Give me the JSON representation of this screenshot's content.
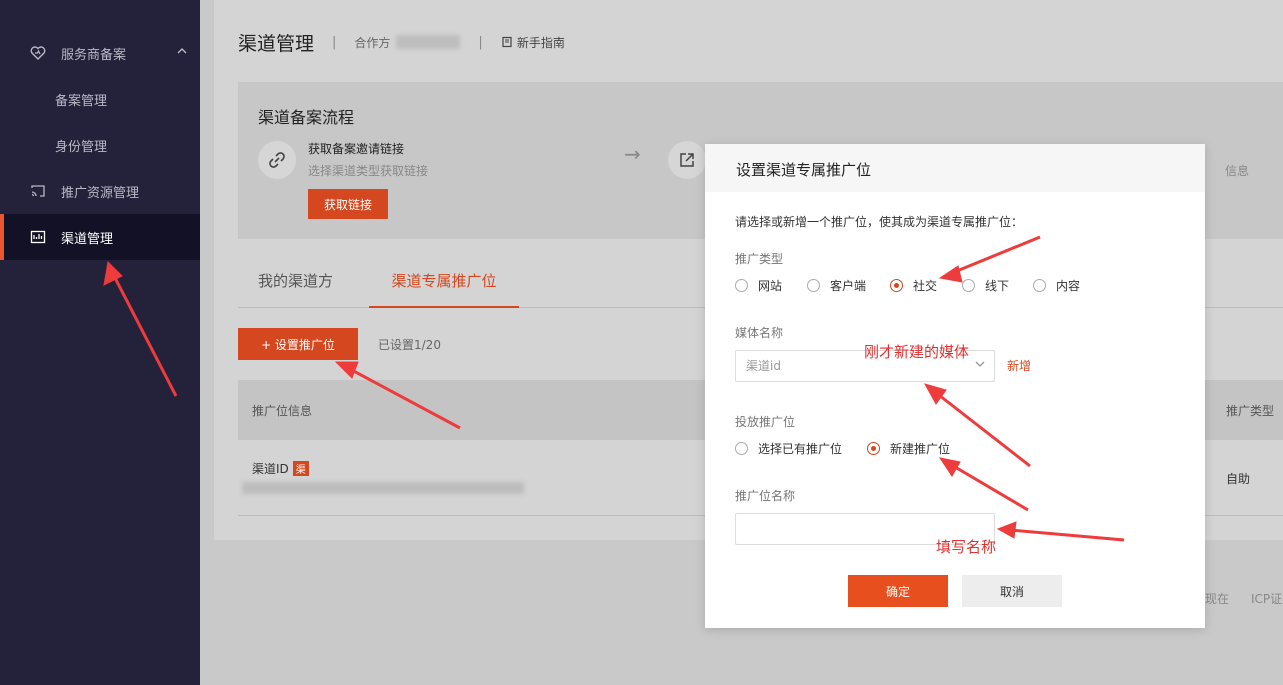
{
  "sidebar": {
    "items": [
      {
        "label": "服务商备案",
        "icon": "heart-icon"
      },
      {
        "label": "备案管理"
      },
      {
        "label": "身份管理"
      },
      {
        "label": "推广资源管理",
        "icon": "cast-icon"
      },
      {
        "label": "渠道管理",
        "icon": "channel-icon",
        "active": true
      }
    ]
  },
  "header": {
    "title": "渠道管理",
    "sep": "|",
    "partner_label": "合作方",
    "guide": "新手指南"
  },
  "flow": {
    "title": "渠道备案流程",
    "step1_title": "获取备案邀请链接",
    "step1_desc": "选择渠道类型获取链接",
    "step1_button": "获取链接",
    "right_fragment": "信息"
  },
  "tabs": [
    "我的渠道方",
    "渠道专属推广位"
  ],
  "toolbar": {
    "add_button": "+ 设置推广位",
    "count": "已设置1/20"
  },
  "table": {
    "headers": [
      "推广位信息",
      "推广类型"
    ],
    "row": {
      "name": "渠道ID",
      "tag": "渠",
      "type": "自助"
    }
  },
  "footer": {
    "fragment1": "现在",
    "fragment2": "ICP证"
  },
  "modal": {
    "title": "设置渠道专属推广位",
    "intro": "请选择或新增一个推广位，使其成为渠道专属推广位：",
    "promo_type_label": "推广类型",
    "promo_types": [
      "网站",
      "客户端",
      "社交",
      "线下",
      "内容"
    ],
    "promo_type_selected": "社交",
    "media_label": "媒体名称",
    "media_placeholder": "渠道id",
    "add_link": "新增",
    "placement_label": "投放推广位",
    "placement_options": [
      "选择已有推广位",
      "新建推广位"
    ],
    "placement_selected": "新建推广位",
    "name_label": "推广位名称",
    "name_value": "",
    "ok": "确定",
    "cancel": "取消"
  },
  "annotations": {
    "media": "刚才新建的媒体",
    "name": "填写名称"
  },
  "colors": {
    "accent": "#e84f1e",
    "sidebar": "#23223a",
    "annotation": "#e53030"
  }
}
